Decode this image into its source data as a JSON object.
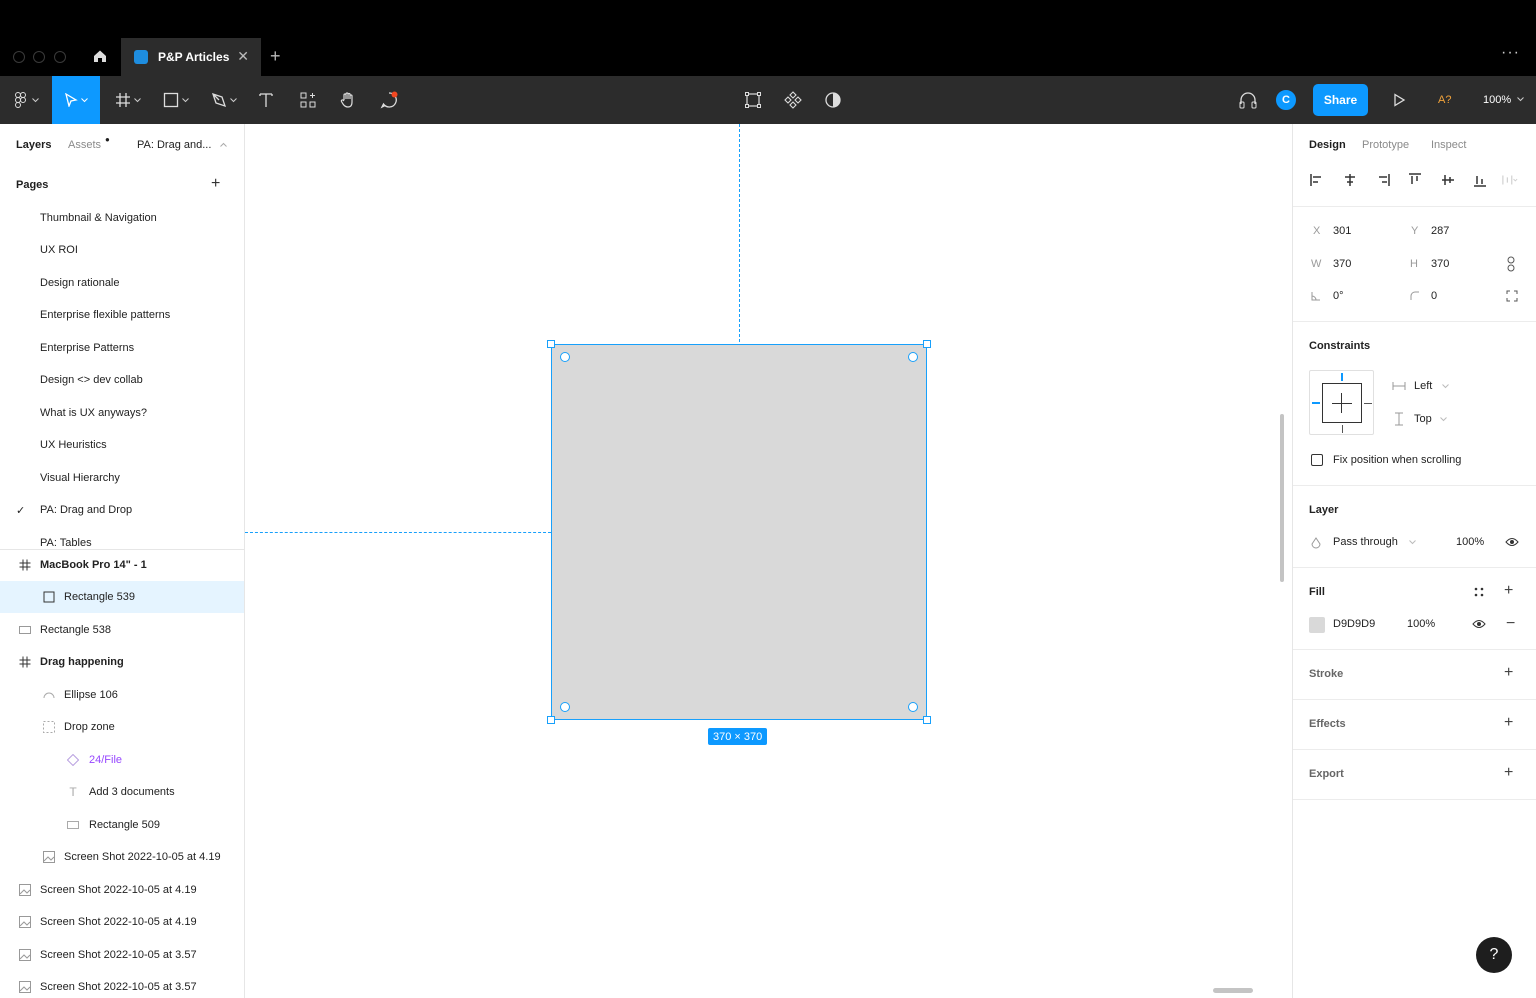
{
  "titlebar": {
    "tab_name": "P&P Articles",
    "tab_close": "✕",
    "new_tab": "+",
    "more": "···"
  },
  "toolbar": {
    "share_label": "Share",
    "avatar_initial": "C",
    "a_question": "A?",
    "zoom": "100%"
  },
  "left_panel": {
    "tabs": {
      "layers": "Layers",
      "assets": "Assets",
      "page_selector": "PA: Drag and..."
    },
    "pages_heading": "Pages",
    "pages": [
      "Thumbnail & Navigation",
      "UX ROI",
      "Design rationale",
      "Enterprise flexible patterns",
      "Enterprise Patterns",
      "Design <> dev collab",
      "What is UX anyways?",
      "UX Heuristics",
      "Visual Hierarchy",
      "PA: Drag and Drop",
      "PA: Tables"
    ],
    "current_page_check": "✓",
    "layers": [
      {
        "name": "MacBook Pro 14\" - 1",
        "icon": "frame-icon"
      },
      {
        "name": "Rectangle 539",
        "icon": "rectangle-icon"
      },
      {
        "name": "Rectangle 538",
        "icon": "rectangle-icon"
      },
      {
        "name": "Drag happening",
        "icon": "frame-icon"
      },
      {
        "name": "Ellipse 106",
        "icon": "ellipse-icon"
      },
      {
        "name": "Drop zone",
        "icon": "dashed-frame-icon"
      },
      {
        "name": "24/File",
        "icon": "component-instance-icon"
      },
      {
        "name": "Add 3 documents",
        "icon": "text-icon"
      },
      {
        "name": "Rectangle 509",
        "icon": "rectangle-icon"
      },
      {
        "name": "Screen Shot 2022-10-05 at 4.19",
        "icon": "image-icon"
      },
      {
        "name": "Screen Shot 2022-10-05 at 4.19",
        "icon": "image-icon"
      },
      {
        "name": "Screen Shot 2022-10-05 at 4.19",
        "icon": "image-icon"
      },
      {
        "name": "Screen Shot 2022-10-05 at 3.57",
        "icon": "image-icon"
      },
      {
        "name": "Screen Shot 2022-10-05 at 3.57",
        "icon": "image-icon"
      }
    ]
  },
  "canvas": {
    "dimension_label": "370 × 370",
    "accent": "#18a0fb",
    "fill": "#d9d9d9"
  },
  "right_panel": {
    "tabs": {
      "design": "Design",
      "prototype": "Prototype",
      "inspect": "Inspect"
    },
    "props": {
      "x_label": "X",
      "x": "301",
      "y_label": "Y",
      "y": "287",
      "w_label": "W",
      "w": "370",
      "h_label": "H",
      "h": "370",
      "rotation": "0°",
      "corner_radius": "0"
    },
    "constraints": {
      "title": "Constraints",
      "horizontal": "Left",
      "vertical": "Top",
      "fix_label": "Fix position when scrolling"
    },
    "layer": {
      "title": "Layer",
      "blend": "Pass through",
      "opacity": "100%"
    },
    "fill": {
      "title": "Fill",
      "hex": "D9D9D9",
      "opacity": "100%"
    },
    "stroke": {
      "title": "Stroke"
    },
    "effects": {
      "title": "Effects"
    },
    "export": {
      "title": "Export"
    },
    "help": "?"
  }
}
